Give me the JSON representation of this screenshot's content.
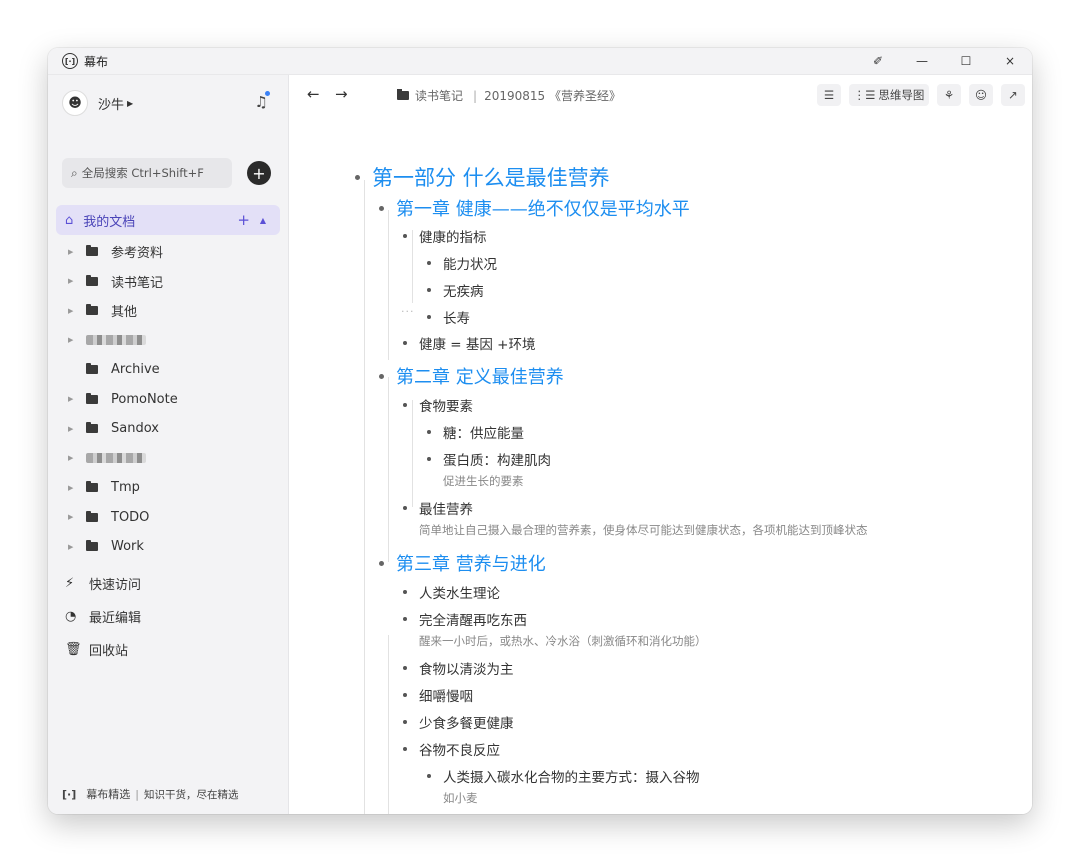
{
  "app": {
    "title": "幕布",
    "logo_text": "[·]"
  },
  "window_controls": {
    "pin": "✐",
    "minimize": "—",
    "maximize": "☐",
    "close": "×"
  },
  "sidebar": {
    "user_name": "沙牛",
    "search_placeholder": "全局搜索 Ctrl+Shift+F",
    "add_label": "+",
    "my_docs": "我的文档",
    "folders": [
      {
        "label": "参考资料",
        "blurred": false,
        "arrow": true
      },
      {
        "label": "读书笔记",
        "blurred": false,
        "arrow": true
      },
      {
        "label": "其他",
        "blurred": false,
        "arrow": true
      },
      {
        "label": "",
        "blurred": true,
        "arrow": true
      },
      {
        "label": "Archive",
        "blurred": false,
        "arrow": false
      },
      {
        "label": "PomoNote",
        "blurred": false,
        "arrow": true
      },
      {
        "label": "Sandox",
        "blurred": false,
        "arrow": true
      },
      {
        "label": "",
        "blurred": true,
        "arrow": true
      },
      {
        "label": "Tmp",
        "blurred": false,
        "arrow": true
      },
      {
        "label": "TODO",
        "blurred": false,
        "arrow": true
      },
      {
        "label": "Work",
        "blurred": false,
        "arrow": true
      }
    ],
    "quick_access": "快速访问",
    "recent_edits": "最近编辑",
    "trash": "回收站",
    "footer_brand": "幕布精选",
    "footer_tagline": "知识干货，尽在精选"
  },
  "toolbar": {
    "back": "←",
    "forward": "→",
    "breadcrumb_folder": "读书笔记",
    "breadcrumb_doc": "20190815 《营养圣经》",
    "mindmap_label": "思维导图"
  },
  "outline": {
    "part1": "第一部分 什么是最佳营养",
    "ch1": "第一章 健康——绝不仅仅是平均水平",
    "ch1_items": [
      "健康的指标",
      "能力状况",
      "无疾病",
      "长寿",
      "健康 = 基因 +环境"
    ],
    "ch2": "第二章 定义最佳营养",
    "ch2_items": [
      "食物要素",
      "糖：供应能量",
      "蛋白质：构建肌肉",
      "促进生长的要素",
      "最佳营养",
      "简单地让自己摄入最合理的营养素，使身体尽可能达到健康状态，各项机能达到顶峰状态"
    ],
    "ch3": "第三章 营养与进化",
    "ch3_items": [
      "人类水生理论",
      "完全清醒再吃东西",
      "醒来一小时后，或热水、冷水浴（刺激循环和消化功能）",
      "食物以清淡为主",
      "细嚼慢咽",
      "少食多餐更健康",
      "谷物不良反应",
      "人类摄入碳水化合物的主要方式：摄入谷物",
      "如小麦"
    ]
  }
}
